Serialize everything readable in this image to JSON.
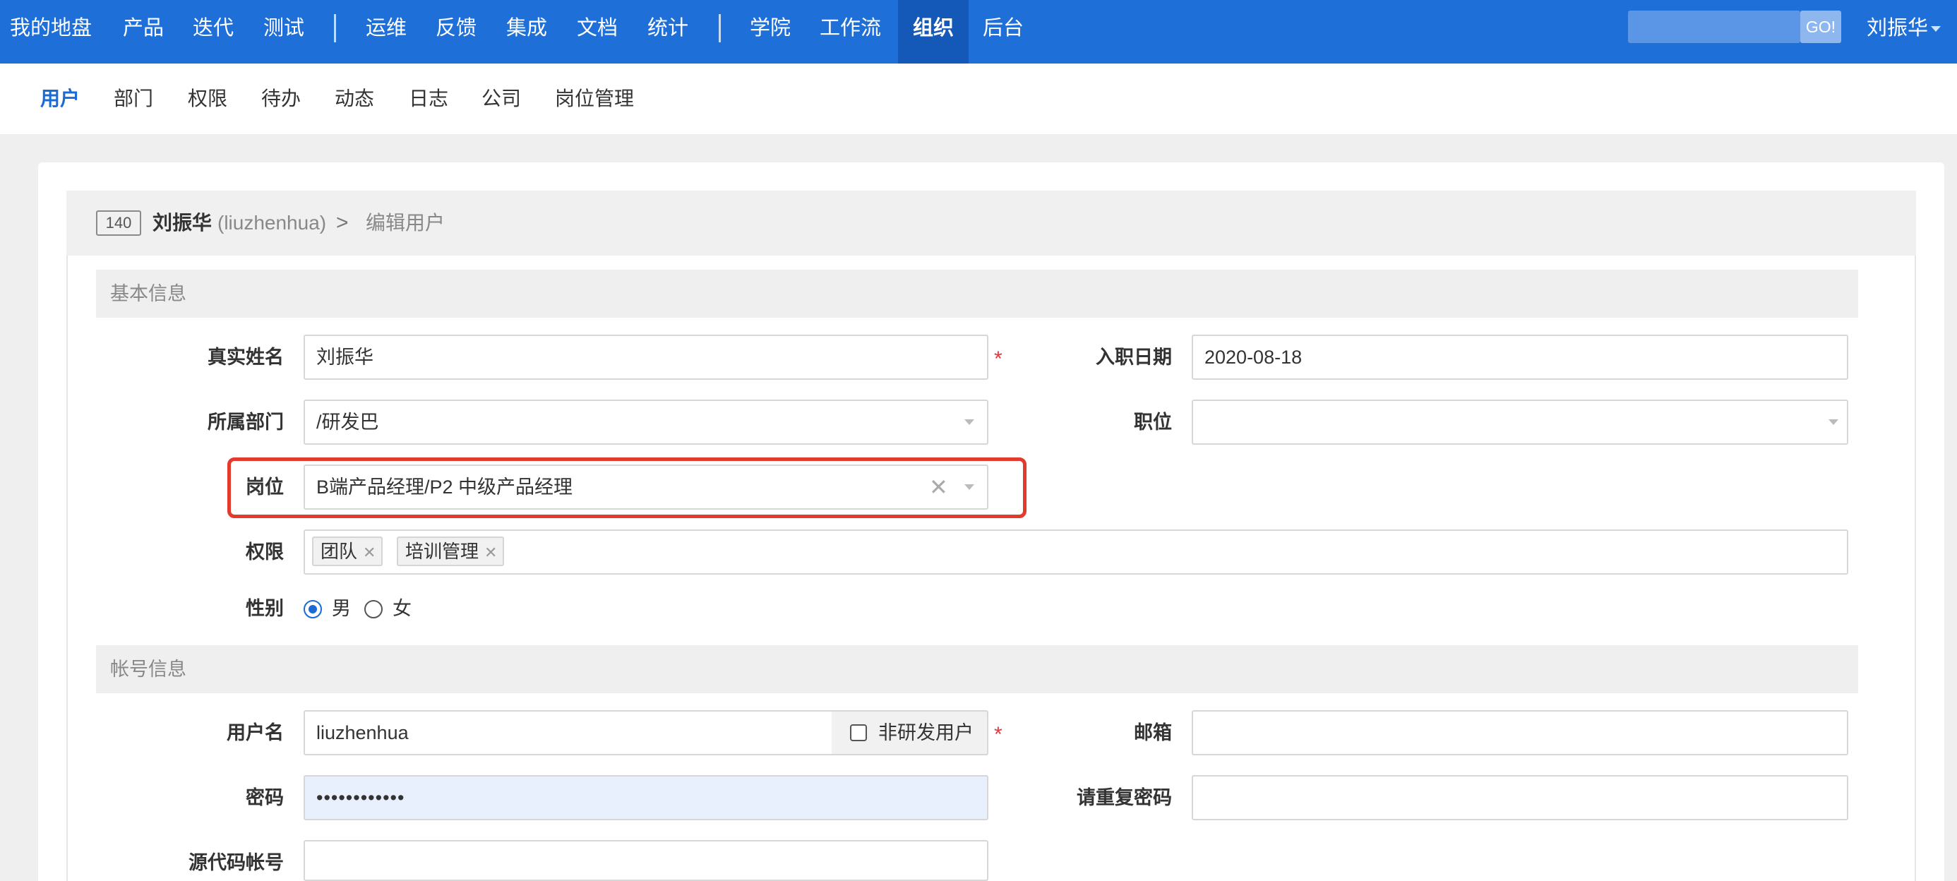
{
  "topnav": {
    "items": [
      "我的地盘",
      "产品",
      "迭代",
      "测试",
      "运维",
      "反馈",
      "集成",
      "文档",
      "统计",
      "学院",
      "工作流",
      "组织",
      "后台"
    ],
    "active": "组织",
    "search": {
      "button": "GO!",
      "placeholder": ""
    },
    "user": "刘振华"
  },
  "subnav": {
    "items": [
      "用户",
      "部门",
      "权限",
      "待办",
      "动态",
      "日志",
      "公司",
      "岗位管理"
    ],
    "active": "用户"
  },
  "header": {
    "id": "140",
    "name": "刘振华",
    "account": "(liuzhenhua)",
    "separator": ">",
    "action": "编辑用户"
  },
  "sections": {
    "basic": "基本信息",
    "account": "帐号信息"
  },
  "form": {
    "realname": {
      "label": "真实姓名",
      "value": "刘振华",
      "required": "*"
    },
    "join_date": {
      "label": "入职日期",
      "value": "2020-08-18"
    },
    "dept": {
      "label": "所属部门",
      "value": "/研发巴"
    },
    "role": {
      "label": "职位",
      "value": ""
    },
    "post": {
      "label": "岗位",
      "value": "B端产品经理/P2 中级产品经理",
      "clear": "✕"
    },
    "rights": {
      "label": "权限",
      "tags": [
        "团队",
        "培训管理"
      ],
      "remove": "✕"
    },
    "gender": {
      "label": "性别",
      "options": [
        "男",
        "女"
      ],
      "selected": "男"
    },
    "username": {
      "label": "用户名",
      "value": "liuzhenhua",
      "required": "*",
      "non_dev_label": "非研发用户",
      "non_dev_checked": false
    },
    "email": {
      "label": "邮箱",
      "value": ""
    },
    "password": {
      "label": "密码",
      "value": "••••••••••••"
    },
    "password_repeat": {
      "label": "请重复密码",
      "value": ""
    },
    "source_account": {
      "label": "源代码帐号",
      "value": ""
    }
  },
  "colors": {
    "nav_bg": "#1f6fd9",
    "nav_active_bg": "#1458b8",
    "accent": "#1a6bd6",
    "required": "#e0393e",
    "highlight": "#e23a2d"
  },
  "icons": {
    "separator": "chevron-right-icon",
    "select": "chevron-down-icon",
    "clear": "close-icon"
  }
}
